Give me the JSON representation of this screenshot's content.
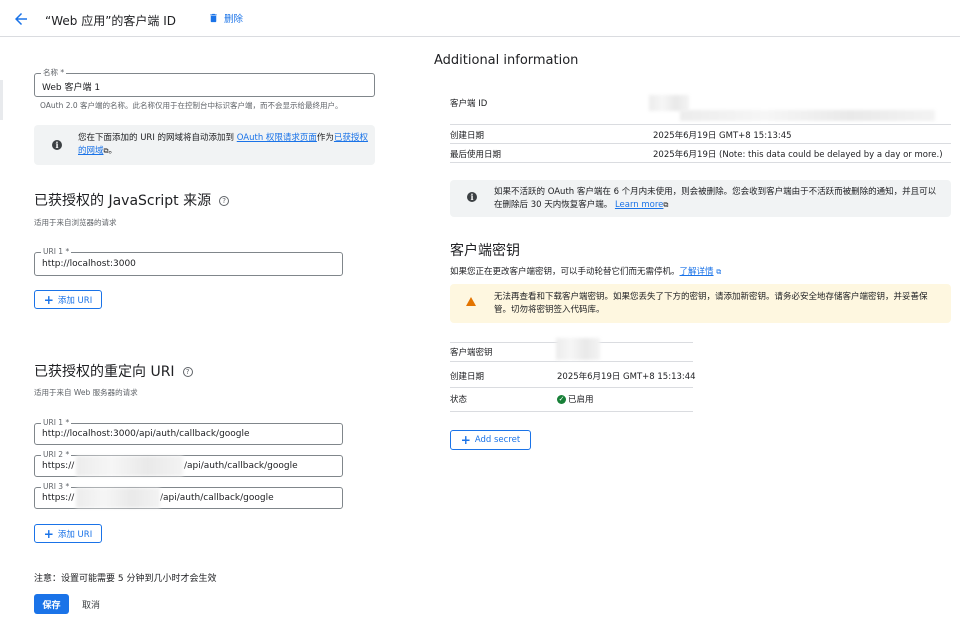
{
  "header": {
    "title": "“Web 应用”的客户端 ID",
    "delete_label": "删除"
  },
  "name_field": {
    "label": "名称 *",
    "value": "Web 客户端 1",
    "hint": "OAuth 2.0 客户端的名称。此名称仅用于在控制台中标识客户端，而不会显示给最终用户。"
  },
  "uri_notice": {
    "text_before": "您在下面添加的 URI 的网域将自动添加到 ",
    "link1": "OAuth 权限请求页面",
    "text_middle": "作为",
    "link2": "已获授权的网域",
    "text_after": "。"
  },
  "js_origins": {
    "title": "已获授权的 JavaScript 来源",
    "subtitle": "适用于来自浏览器的请求",
    "uris": [
      {
        "label": "URI 1 *",
        "value": "http://localhost:3000"
      }
    ],
    "add_label": "添加 URI"
  },
  "redirect_uris": {
    "title": "已获授权的重定向 URI",
    "subtitle": "适用于来自 Web 服务器的请求",
    "uris": [
      {
        "label": "URI 1 *",
        "value": "http://localhost:3000/api/auth/callback/google"
      },
      {
        "label": "URI 2 *",
        "prefix": "https://",
        "suffix": "/api/auth/callback/google"
      },
      {
        "label": "URI 3 *",
        "prefix": "https://",
        "suffix": "/api/auth/callback/google"
      }
    ],
    "add_label": "添加 URI"
  },
  "footer": {
    "note": "注意：设置可能需要 5 分钟到几小时才会生效",
    "save_label": "保存",
    "cancel_label": "取消"
  },
  "additional_info": {
    "title": "Additional information",
    "rows": [
      {
        "key": "客户端 ID",
        "value": ""
      },
      {
        "key": "创建日期",
        "value": "2025年6月19日 GMT+8 15:13:45"
      },
      {
        "key": "最后使用日期",
        "value": "2025年6月19日 (Note: this data could be delayed by a day or more.)"
      }
    ],
    "inactive_notice": {
      "text": "如果不活跃的 OAuth 客户端在 6 个月内未使用，则会被删除。您会收到客户端由于不活跃而被删除的通知，并且可以在删除后 30 天内恢复客户端。",
      "link": "Learn more"
    }
  },
  "client_secret": {
    "title": "客户端密钥",
    "desc": "如果您正在更改客户端密钥，可以手动轮替它们而无需停机。",
    "desc_link": "了解详情",
    "warning": "无法再查看和下载客户端密钥。如果您丢失了下方的密钥，请添加新密钥。请务必安全地存储客户端密钥，并妥善保管。切勿将密钥签入代码库。",
    "rows": [
      {
        "key": "客户端密钥",
        "value": ""
      },
      {
        "key": "创建日期",
        "value": "2025年6月19日 GMT+8 15:13:44"
      },
      {
        "key": "状态",
        "value": "已启用"
      }
    ],
    "add_label": "Add secret"
  },
  "colors": {
    "accent": "#1a73e8",
    "warning_bg": "#fef7e0",
    "success": "#188038"
  }
}
